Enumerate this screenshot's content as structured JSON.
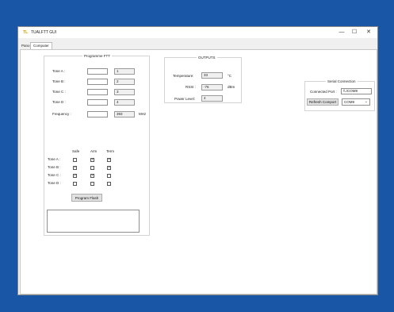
{
  "window": {
    "app_icon": "TL",
    "title": "TUALFTT GUI",
    "minimize": "—",
    "maximize": "☐",
    "close": "✕"
  },
  "tabs": [
    {
      "label": "Pano"
    },
    {
      "label": "Computer"
    }
  ],
  "programme": {
    "title": "Programme FTT",
    "tones": [
      {
        "label": "Tone A :",
        "value": "",
        "readout": "1"
      },
      {
        "label": "Tone B :",
        "value": "",
        "readout": "2"
      },
      {
        "label": "Tone C :",
        "value": "",
        "readout": "3"
      },
      {
        "label": "Tone D :",
        "value": "",
        "readout": "4"
      }
    ],
    "frequency": {
      "label": "Frequency :",
      "value": "",
      "readout": "393",
      "unit": "MHz"
    },
    "matrix_headers": [
      "Safe",
      "Arm",
      "Term"
    ],
    "matrix_rows": [
      {
        "label": "Tone A :",
        "checks": [
          false,
          true,
          true
        ]
      },
      {
        "label": "Tone B :",
        "checks": [
          true,
          false,
          true
        ]
      },
      {
        "label": "Tone C :",
        "checks": [
          true,
          true,
          false
        ]
      },
      {
        "label": "Tone D :",
        "checks": [
          false,
          false,
          false
        ]
      }
    ],
    "program_button": "Program Flash",
    "log_text": ""
  },
  "outputs": {
    "title": "OUTPUTS",
    "rows": [
      {
        "label": "Temperature:",
        "value": "33",
        "unit": "°C"
      },
      {
        "label": "RSSI :",
        "value": "-76",
        "unit": "dBm"
      },
      {
        "label": "Power Level:",
        "value": "4",
        "unit": ""
      }
    ]
  },
  "serial": {
    "title": "Serial Connection",
    "port_label": "Connected Port :",
    "port_value": "\\\\.\\COM9",
    "refresh_button": "Refresh Comport",
    "selected_port": "COM9"
  },
  "icons": {
    "dropdown": "chevron-down-icon",
    "check": "checkmark-icon"
  }
}
